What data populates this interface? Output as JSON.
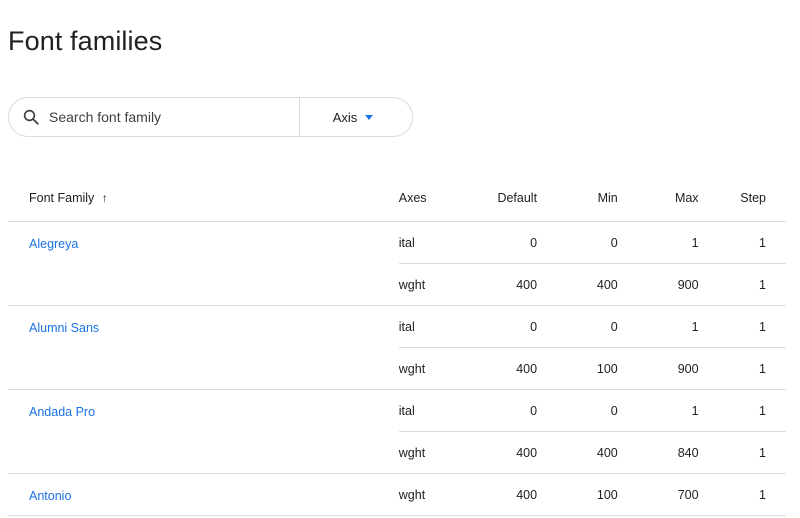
{
  "page": {
    "title": "Font families"
  },
  "search": {
    "placeholder": "Search font family",
    "value": "",
    "icon": "search-icon"
  },
  "axis_filter": {
    "label": "Axis",
    "icon": "caret-down-icon",
    "accent_color": "#1a73e8"
  },
  "table": {
    "headers": {
      "family": "Font Family",
      "sort_indicator": "↑",
      "axes": "Axes",
      "default": "Default",
      "min": "Min",
      "max": "Max",
      "step": "Step"
    },
    "families": [
      {
        "name": "Alegreya",
        "axes": [
          {
            "tag": "ital",
            "default": "0",
            "min": "0",
            "max": "1",
            "step": "1"
          },
          {
            "tag": "wght",
            "default": "400",
            "min": "400",
            "max": "900",
            "step": "1"
          }
        ]
      },
      {
        "name": "Alumni Sans",
        "axes": [
          {
            "tag": "ital",
            "default": "0",
            "min": "0",
            "max": "1",
            "step": "1"
          },
          {
            "tag": "wght",
            "default": "400",
            "min": "100",
            "max": "900",
            "step": "1"
          }
        ]
      },
      {
        "name": "Andada Pro",
        "axes": [
          {
            "tag": "ital",
            "default": "0",
            "min": "0",
            "max": "1",
            "step": "1"
          },
          {
            "tag": "wght",
            "default": "400",
            "min": "400",
            "max": "840",
            "step": "1"
          }
        ]
      },
      {
        "name": "Antonio",
        "axes": [
          {
            "tag": "wght",
            "default": "400",
            "min": "100",
            "max": "700",
            "step": "1"
          }
        ]
      }
    ]
  },
  "colors": {
    "link": "#1a73e8",
    "divider": "#dadce0",
    "text": "#202124"
  }
}
